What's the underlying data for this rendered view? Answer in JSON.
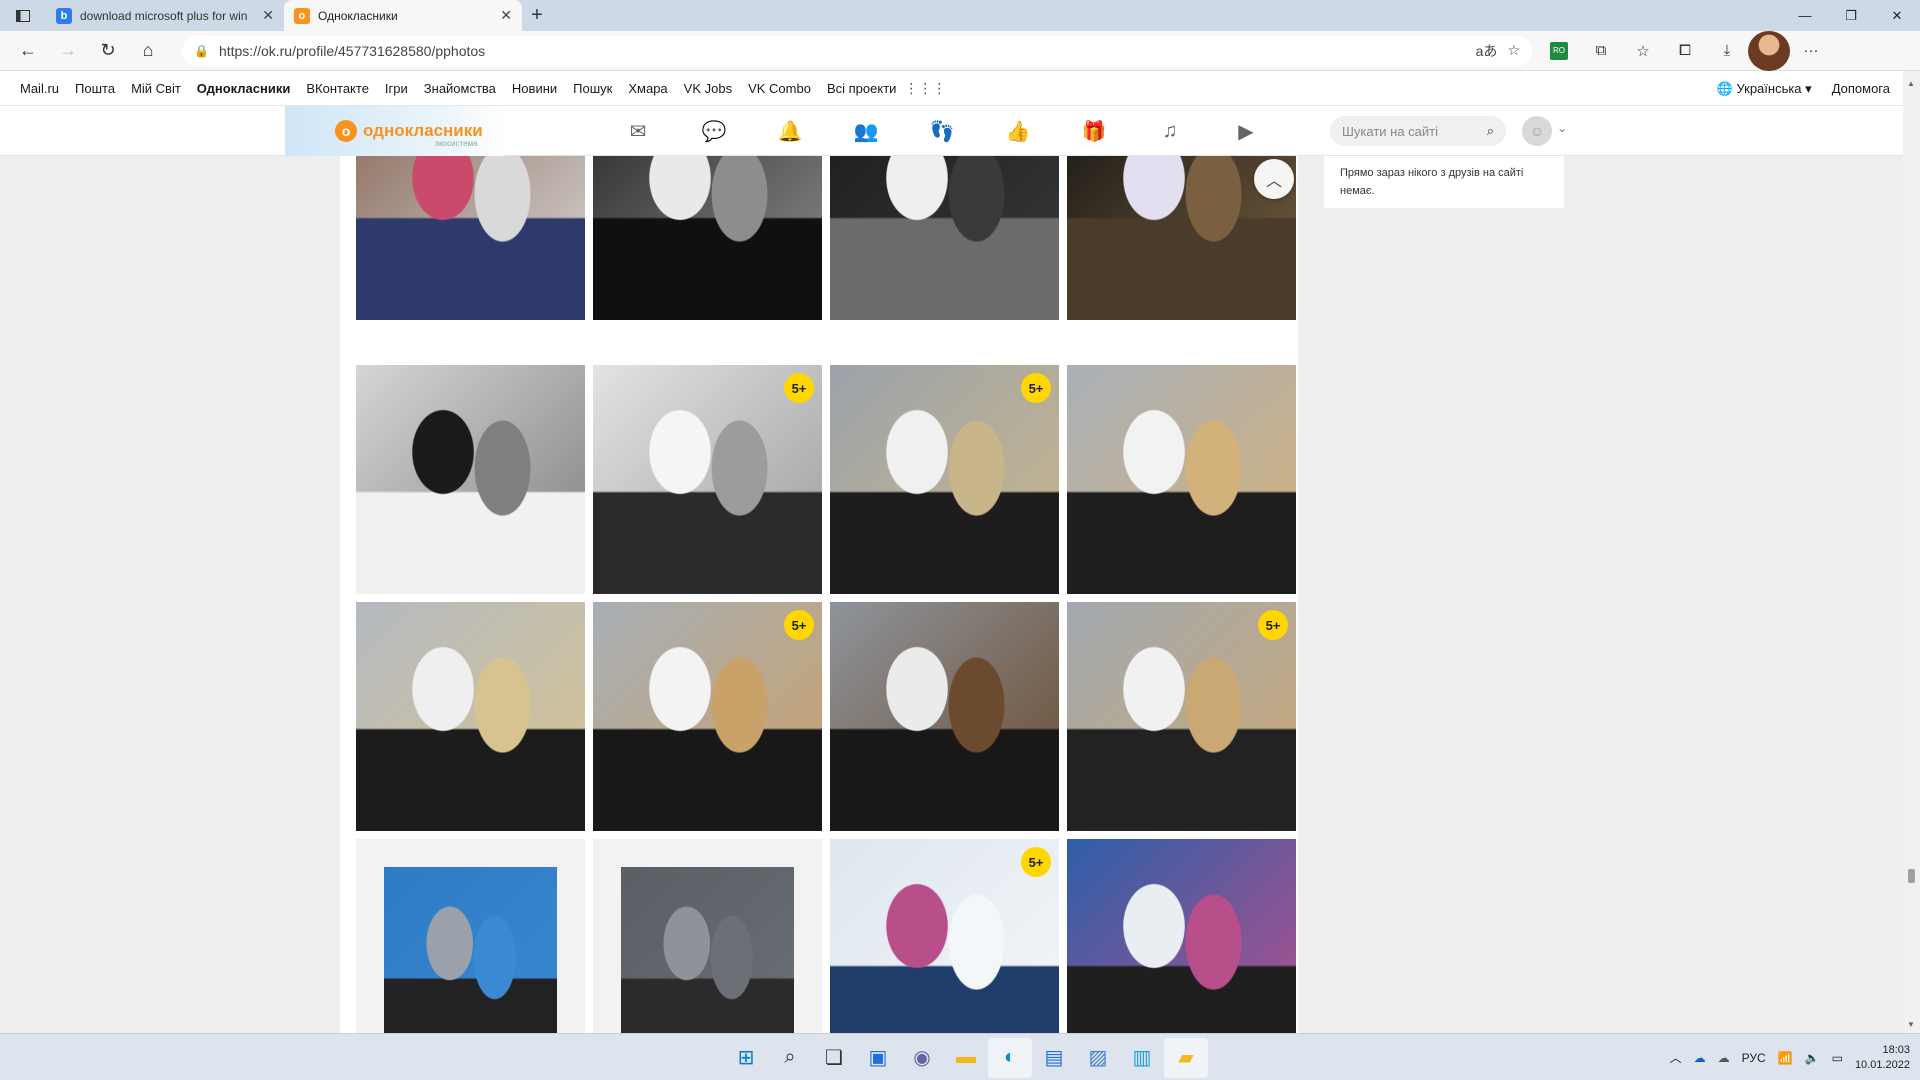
{
  "browser": {
    "tabs": [
      {
        "title": "download microsoft plus for win",
        "favicon": "bing-icon",
        "active": false
      },
      {
        "title": "Однокласники",
        "favicon": "ok-icon",
        "active": true
      }
    ],
    "url": "https://ok.ru/profile/457731628580/pphotos",
    "colors": {
      "tabstrip": "#cdd9e6",
      "toolbar": "#f7f7f7"
    }
  },
  "portal": {
    "links": [
      "Mail.ru",
      "Пошта",
      "Мій Світ",
      "Однокласники",
      "ВКонтакте",
      "Ігри",
      "Знайомства",
      "Новини",
      "Пошук",
      "Хмара",
      "VK Jobs",
      "VK Combo",
      "Всі проекти"
    ],
    "language": "Українська ▾",
    "help": "Допомога"
  },
  "ok": {
    "logo_text": "однокласники",
    "logo_sub": "экосистема",
    "search_placeholder": "Шукати на сайті",
    "nav_icons": [
      "mail-icon",
      "chat-icon",
      "bell-icon",
      "friends-icon",
      "guests-icon",
      "like-icon",
      "gifts-icon",
      "music-icon",
      "video-icon"
    ],
    "accent": "#f7931e"
  },
  "sidebar": {
    "text": "Прямо зараз нікого з друзів на сайті немає."
  },
  "photos": [
    {
      "badge": "",
      "palette": [
        "#8a6a5a",
        "#c94a6a",
        "#2e3b6a",
        "#d9d9d9"
      ]
    },
    {
      "badge": "",
      "palette": [
        "#2a2a2a",
        "#e9e9e9",
        "#101010",
        "#8d8d8d"
      ]
    },
    {
      "badge": "",
      "palette": [
        "#1c1c1c",
        "#efefef",
        "#6b6b6b",
        "#3a3a3a"
      ]
    },
    {
      "badge": "",
      "palette": [
        "#151515",
        "#e2dff0",
        "#4a3b2a",
        "#7a6040"
      ]
    },
    {
      "badge": "",
      "palette": [
        "#d5d5d5",
        "#1a1a1a",
        "#f1f1f1",
        "#7f7f7f"
      ]
    },
    {
      "badge": "5+",
      "palette": [
        "#e3e3e3",
        "#f5f5f5",
        "#2b2b2b",
        "#9c9c9c"
      ]
    },
    {
      "badge": "5+",
      "palette": [
        "#9da3ab",
        "#f0f0f0",
        "#1d1d1d",
        "#c8b68a"
      ]
    },
    {
      "badge": "",
      "palette": [
        "#aab0b8",
        "#f2f2f2",
        "#1e1e1e",
        "#d2b17a"
      ]
    },
    {
      "badge": "",
      "palette": [
        "#b5bac1",
        "#efefef",
        "#1c1c1c",
        "#d6c390"
      ]
    },
    {
      "badge": "5+",
      "palette": [
        "#a8aeb5",
        "#f3f3f3",
        "#181818",
        "#c9a26a"
      ]
    },
    {
      "badge": "",
      "palette": [
        "#8e949b",
        "#ebebeb",
        "#181818",
        "#6b4a2e"
      ]
    },
    {
      "badge": "5+",
      "palette": [
        "#a3a9b0",
        "#f1f1f1",
        "#222222",
        "#c9a874"
      ]
    },
    {
      "badge": "",
      "framed": true,
      "palette": [
        "#2d7bc4",
        "#9aa1aa",
        "#222222",
        "#3a8ad3"
      ]
    },
    {
      "badge": "",
      "framed": true,
      "palette": [
        "#5a5f66",
        "#8f9399",
        "#2b2b2b",
        "#6b7077"
      ]
    },
    {
      "badge": "5+",
      "palette": [
        "#dfe7ee",
        "#b84f8b",
        "#1f3c6a",
        "#f4f7fa"
      ]
    },
    {
      "badge": "",
      "palette": [
        "#2d5fa8",
        "#e9eef3",
        "#1f1f1f",
        "#b84f8b"
      ]
    }
  ],
  "taskbar": {
    "apps": [
      "windows-start-icon",
      "search-icon",
      "task-view-icon",
      "widgets-icon",
      "teams-chat-icon",
      "file-explorer-icon",
      "edge-icon",
      "store-icon",
      "photos-app-icon",
      "spreadsheet-icon",
      "folder-app-icon"
    ],
    "lang": "РУС",
    "time": "18:03",
    "date": "10.01.2022"
  }
}
